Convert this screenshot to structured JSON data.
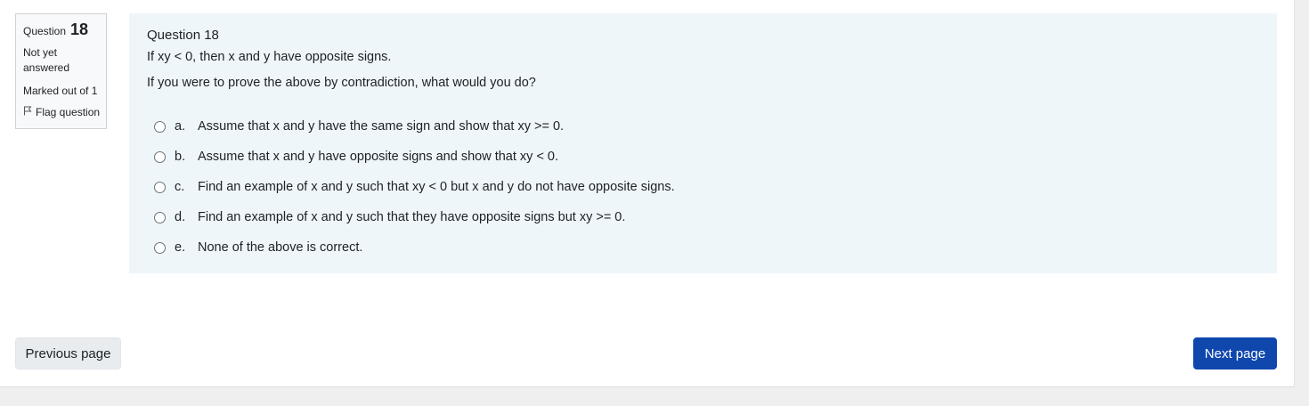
{
  "info": {
    "question_label": "Question",
    "question_number": "18",
    "state": "Not yet answered",
    "grade": "Marked out of 1",
    "flag_label": "Flag question"
  },
  "question": {
    "heading": "Question 18",
    "text": "If xy < 0, then x and y have opposite signs.",
    "prompt": "If you were to prove the above by contradiction, what would you do?",
    "options": [
      {
        "letter": "a.",
        "text": "Assume that x and y have the same sign and show that xy >= 0."
      },
      {
        "letter": "b.",
        "text": "Assume that x and y have opposite signs and show that xy < 0."
      },
      {
        "letter": "c.",
        "text": "Find an example of x and y such that xy < 0 but x and y do not have opposite signs."
      },
      {
        "letter": "d.",
        "text": "Find an example of x and y such that they have opposite signs but xy >= 0."
      },
      {
        "letter": "e.",
        "text": "None of the above is correct."
      }
    ]
  },
  "navigation": {
    "previous_label": "Previous page",
    "next_label": "Next page"
  },
  "colors": {
    "content_background": "#eef6fa",
    "next_button": "#0f47ad",
    "previous_button": "#e9ecef"
  },
  "icons": {
    "flag": "flag-icon",
    "radio": "radio-icon"
  }
}
